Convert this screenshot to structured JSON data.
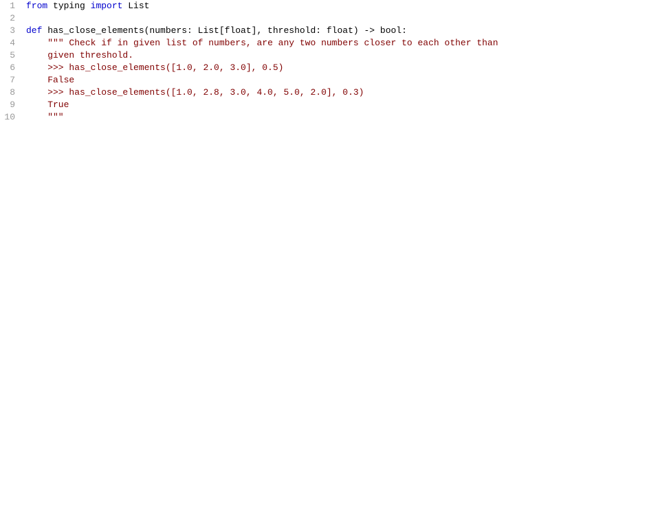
{
  "editor": {
    "lines": [
      {
        "number": 1,
        "tokens": [
          {
            "type": "kw-import",
            "text": "from"
          },
          {
            "type": "normal",
            "text": " typing "
          },
          {
            "type": "kw-import",
            "text": "import"
          },
          {
            "type": "normal",
            "text": " List"
          }
        ]
      },
      {
        "number": 2,
        "tokens": []
      },
      {
        "number": 3,
        "tokens": [
          {
            "type": "kw-def",
            "text": "def"
          },
          {
            "type": "normal",
            "text": " has_close_elements(numbers: List[float], threshold: float) -> bool:"
          }
        ]
      },
      {
        "number": 4,
        "tokens": [
          {
            "type": "normal",
            "text": "    "
          },
          {
            "type": "docstring",
            "text": "\"\"\" Check if in given list of numbers, are any two numbers closer to each other than"
          }
        ]
      },
      {
        "number": 5,
        "tokens": [
          {
            "type": "docstring",
            "text": "    given threshold."
          }
        ]
      },
      {
        "number": 6,
        "tokens": [
          {
            "type": "docstring",
            "text": "    >>> has_close_elements([1.0, 2.0, 3.0], 0.5)"
          }
        ]
      },
      {
        "number": 7,
        "tokens": [
          {
            "type": "docstring",
            "text": "    False"
          }
        ]
      },
      {
        "number": 8,
        "tokens": [
          {
            "type": "docstring",
            "text": "    >>> has_close_elements([1.0, 2.8, 3.0, 4.0, 5.0, 2.0], 0.3)"
          }
        ]
      },
      {
        "number": 9,
        "tokens": [
          {
            "type": "docstring",
            "text": "    True"
          }
        ]
      },
      {
        "number": 10,
        "tokens": [
          {
            "type": "docstring",
            "text": "    \"\"\""
          }
        ]
      }
    ]
  }
}
